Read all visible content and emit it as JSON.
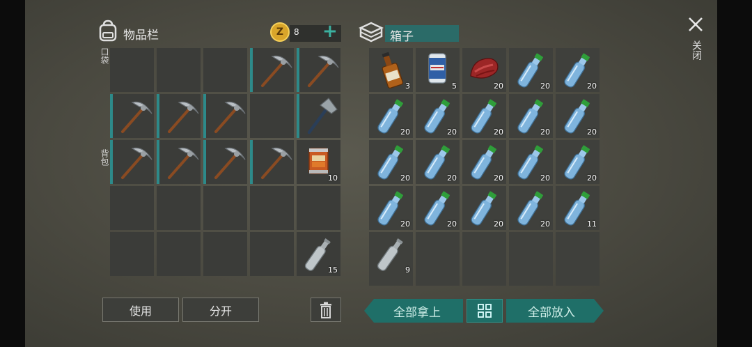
{
  "inventory": {
    "title": "物品栏",
    "coins": "8",
    "add_symbol": "+",
    "pocket_label": "口袋",
    "backpack_label": "背包",
    "slots": [
      {
        "item": "",
        "qty": ""
      },
      {
        "item": "",
        "qty": ""
      },
      {
        "item": "",
        "qty": ""
      },
      {
        "item": "pickaxe",
        "qty": ""
      },
      {
        "item": "pickaxe",
        "qty": ""
      },
      {
        "item": "pickaxe",
        "qty": ""
      },
      {
        "item": "pickaxe",
        "qty": ""
      },
      {
        "item": "pickaxe",
        "qty": ""
      },
      {
        "item": "",
        "qty": ""
      },
      {
        "item": "hatchet",
        "qty": ""
      },
      {
        "item": "pickaxe",
        "qty": ""
      },
      {
        "item": "pickaxe",
        "qty": ""
      },
      {
        "item": "pickaxe",
        "qty": ""
      },
      {
        "item": "pickaxe",
        "qty": ""
      },
      {
        "item": "canned-food",
        "qty": "10"
      },
      {
        "item": "",
        "qty": ""
      },
      {
        "item": "",
        "qty": ""
      },
      {
        "item": "",
        "qty": ""
      },
      {
        "item": "",
        "qty": ""
      },
      {
        "item": "",
        "qty": ""
      },
      {
        "item": "",
        "qty": ""
      },
      {
        "item": "",
        "qty": ""
      },
      {
        "item": "",
        "qty": ""
      },
      {
        "item": "",
        "qty": ""
      },
      {
        "item": "empty-bottle",
        "qty": "15"
      }
    ],
    "use_label": "使用",
    "split_label": "分开"
  },
  "box": {
    "title": "箱子",
    "slots": [
      {
        "item": "whiskey",
        "qty": "3"
      },
      {
        "item": "beer-can",
        "qty": "5"
      },
      {
        "item": "meat",
        "qty": "20"
      },
      {
        "item": "water-bottle",
        "qty": "20"
      },
      {
        "item": "water-bottle",
        "qty": "20"
      },
      {
        "item": "water-bottle",
        "qty": "20"
      },
      {
        "item": "water-bottle",
        "qty": "20"
      },
      {
        "item": "water-bottle",
        "qty": "20"
      },
      {
        "item": "water-bottle",
        "qty": "20"
      },
      {
        "item": "water-bottle",
        "qty": "20"
      },
      {
        "item": "water-bottle",
        "qty": "20"
      },
      {
        "item": "water-bottle",
        "qty": "20"
      },
      {
        "item": "water-bottle",
        "qty": "20"
      },
      {
        "item": "water-bottle",
        "qty": "20"
      },
      {
        "item": "water-bottle",
        "qty": "20"
      },
      {
        "item": "water-bottle",
        "qty": "20"
      },
      {
        "item": "water-bottle",
        "qty": "20"
      },
      {
        "item": "water-bottle",
        "qty": "20"
      },
      {
        "item": "water-bottle",
        "qty": "20"
      },
      {
        "item": "water-bottle",
        "qty": "11"
      },
      {
        "item": "empty-bottle",
        "qty": "9"
      },
      {
        "item": "",
        "qty": ""
      },
      {
        "item": "",
        "qty": ""
      },
      {
        "item": "",
        "qty": ""
      },
      {
        "item": "",
        "qty": ""
      }
    ],
    "take_all_label": "全部拿上",
    "put_all_label": "全部放入"
  },
  "close_label": "关闭",
  "colors": {
    "accent": "#2d8a8a",
    "button_teal": "#1f6f68",
    "coin": "#d9a52a"
  }
}
